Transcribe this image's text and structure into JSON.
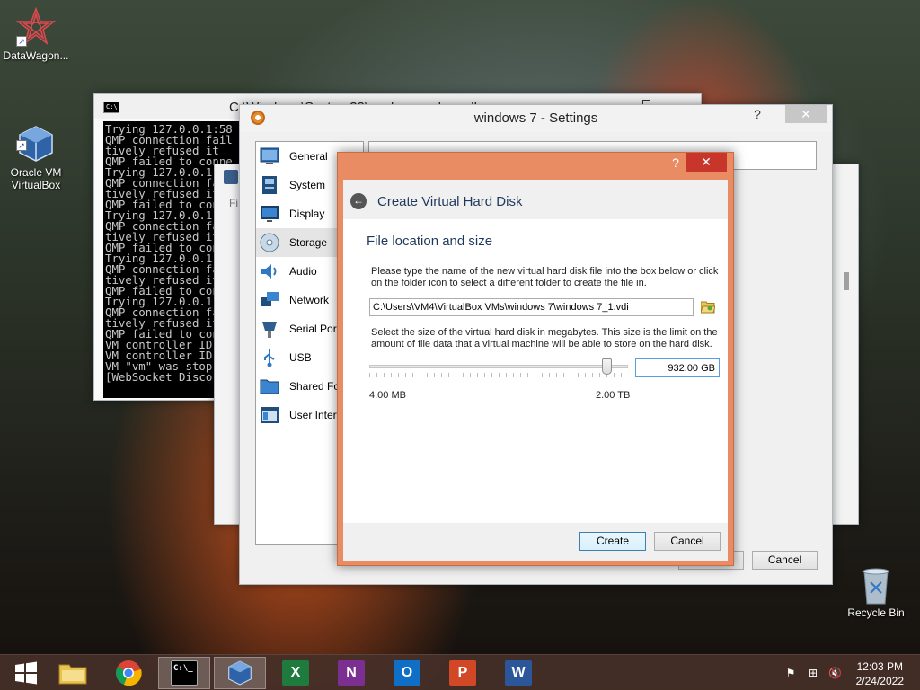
{
  "desktop": {
    "icons": [
      {
        "label": "DataWagon..."
      },
      {
        "label": "Oracle VM\nVirtualBox"
      }
    ],
    "recycle_bin": "Recycle Bin"
  },
  "console": {
    "title": "C:\\Windows\\System32\\cmd.exe - vboxsdl",
    "lines": [
      "Trying 127.0.0.1:58",
      "QMP connection fail",
      "tively refused it",
      "QMP failed to conne",
      "Trying 127.0.0.1:58",
      "QMP connection fail",
      "tively refused it",
      "QMP failed to conne",
      "Trying 127.0.0.1:58",
      "QMP connection fail",
      "tively refused it",
      "QMP failed to conne",
      "Trying 127.0.0.1:58",
      "QMP connection fail",
      "tively refused it",
      "QMP failed to conne",
      "Trying 127.0.0.1:58",
      "QMP connection fail",
      "tively refused it",
      "QMP failed to conne",
      "VM controller ID",
      "VM controller ID",
      "VM \"vm\" was stop",
      "[WebSocket Disco"
    ]
  },
  "manager": {
    "file_menu": "Fi"
  },
  "settings": {
    "title": "windows 7 - Settings",
    "help": "?",
    "close": "✕",
    "categories": [
      {
        "label": "General",
        "icon": "general-icon"
      },
      {
        "label": "System",
        "icon": "system-icon"
      },
      {
        "label": "Display",
        "icon": "display-icon"
      },
      {
        "label": "Storage",
        "icon": "storage-icon"
      },
      {
        "label": "Audio",
        "icon": "audio-icon"
      },
      {
        "label": "Network",
        "icon": "network-icon"
      },
      {
        "label": "Serial Ports",
        "icon": "serial-ports-icon"
      },
      {
        "label": "USB",
        "icon": "usb-icon"
      },
      {
        "label": "Shared Folders",
        "icon": "shared-folders-icon"
      },
      {
        "label": "User Interface",
        "icon": "user-interface-icon"
      }
    ],
    "selected_category": "Storage",
    "cancel_label": "Cancel"
  },
  "dialog": {
    "help": "?",
    "close": "✕",
    "title": "Create Virtual Hard Disk",
    "heading": "File location and size",
    "location_desc": "Please type the name of the new virtual hard disk file into the box below or click on the folder icon to select a different folder to create the file in.",
    "path_value": "C:\\Users\\VM4\\VirtualBox VMs\\windows 7\\windows 7_1.vdi",
    "size_desc": "Select the size of the virtual hard disk in megabytes. This size is the limit on the amount of file data that a virtual machine will be able to store on the hard disk.",
    "size_value": "932.00 GB",
    "slider_fraction": 0.92,
    "min_label": "4.00 MB",
    "max_label": "2.00 TB",
    "create_label": "Create",
    "cancel_label": "Cancel"
  },
  "taskbar": {
    "apps": [
      {
        "name": "start-button",
        "glyph": "",
        "color": "#46302a"
      },
      {
        "name": "file-explorer-app",
        "glyph": "",
        "color": "#e8c24f"
      },
      {
        "name": "chrome-app",
        "glyph": "",
        "color": "#4285f4"
      },
      {
        "name": "cmd-app",
        "glyph": "C:\\_",
        "color": "#000000"
      },
      {
        "name": "virtualbox-app",
        "glyph": "",
        "color": "#3c5e8a"
      },
      {
        "name": "excel-app",
        "glyph": "X",
        "color": "#1f7a3d"
      },
      {
        "name": "onenote-app",
        "glyph": "N",
        "color": "#7b2f91"
      },
      {
        "name": "outlook-app",
        "glyph": "O",
        "color": "#0f6fc6"
      },
      {
        "name": "powerpoint-app",
        "glyph": "P",
        "color": "#d24726"
      },
      {
        "name": "word-app",
        "glyph": "W",
        "color": "#2b579a"
      }
    ],
    "time": "12:03 PM",
    "date": "2/24/2022"
  },
  "colors": {
    "dialog_frame": "#e98c64",
    "dialog_close": "#c7352b",
    "heading_text": "#1e395b"
  }
}
